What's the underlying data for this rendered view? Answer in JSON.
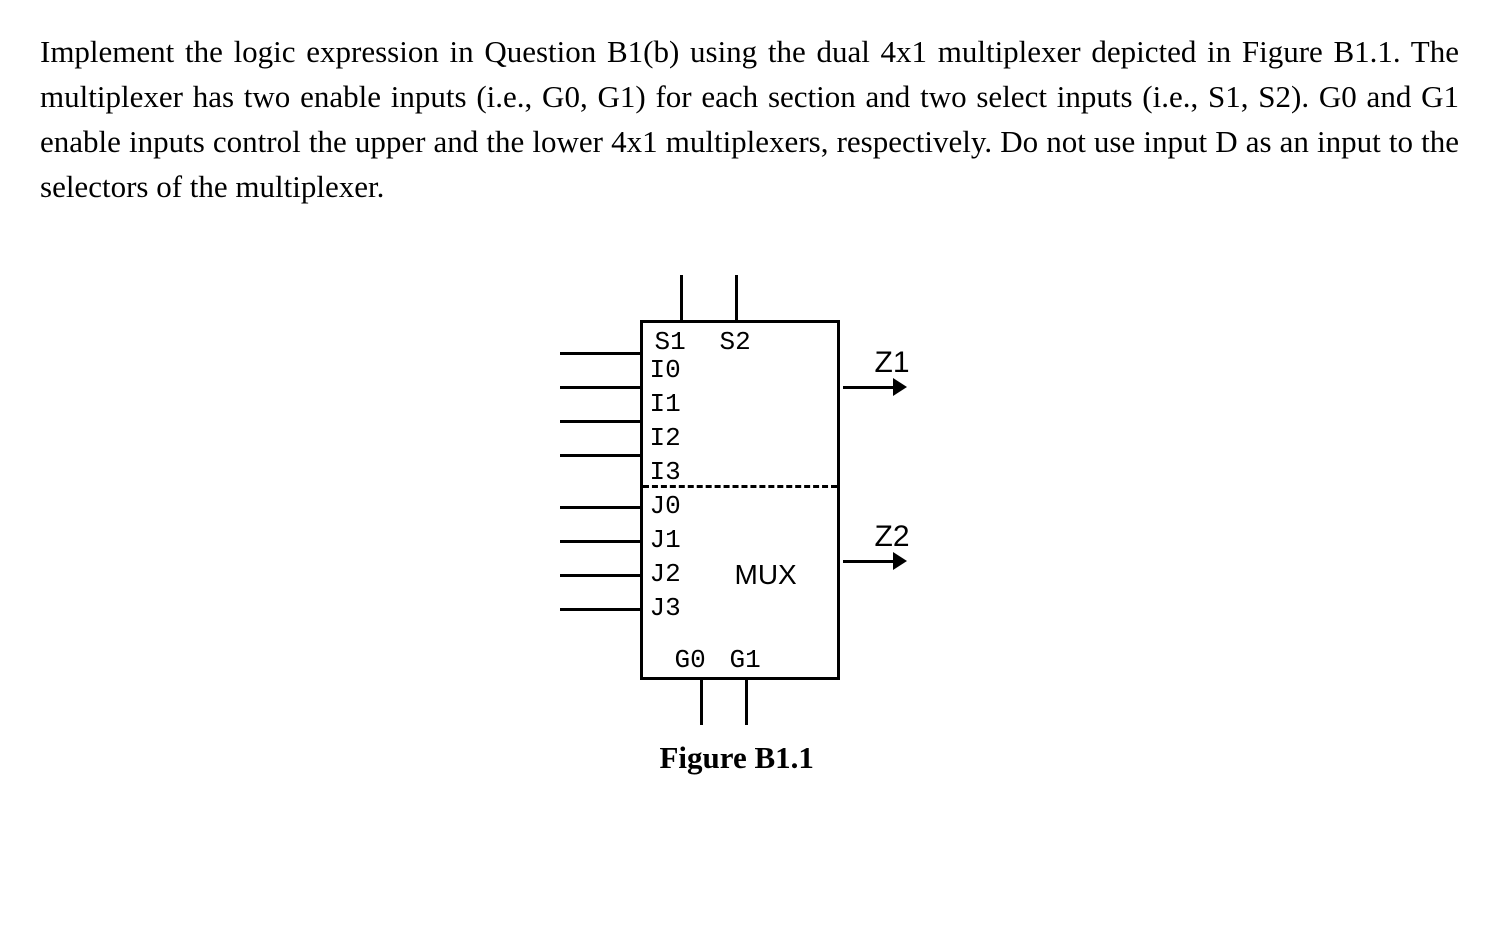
{
  "question": "Implement the logic expression in Question B1(b) using the dual 4x1 multiplexer depicted in Figure B1.1. The multiplexer has two enable inputs (i.e., G0, G1) for each section and two select inputs (i.e., S1, S2). G0 and G1 enable inputs control the upper and the lower 4x1 multiplexers, respectively. Do not use input D as an input to the selectors of the multiplexer.",
  "diagram": {
    "selects": [
      "S1",
      "S2"
    ],
    "upper_inputs": [
      "I0",
      "I1",
      "I2",
      "I3"
    ],
    "lower_inputs": [
      "J0",
      "J1",
      "J2",
      "J3"
    ],
    "enables": [
      "G0",
      "G1"
    ],
    "outputs": [
      "Z1",
      "Z2"
    ],
    "block_label": "MUX",
    "caption": "Figure B1.1"
  }
}
